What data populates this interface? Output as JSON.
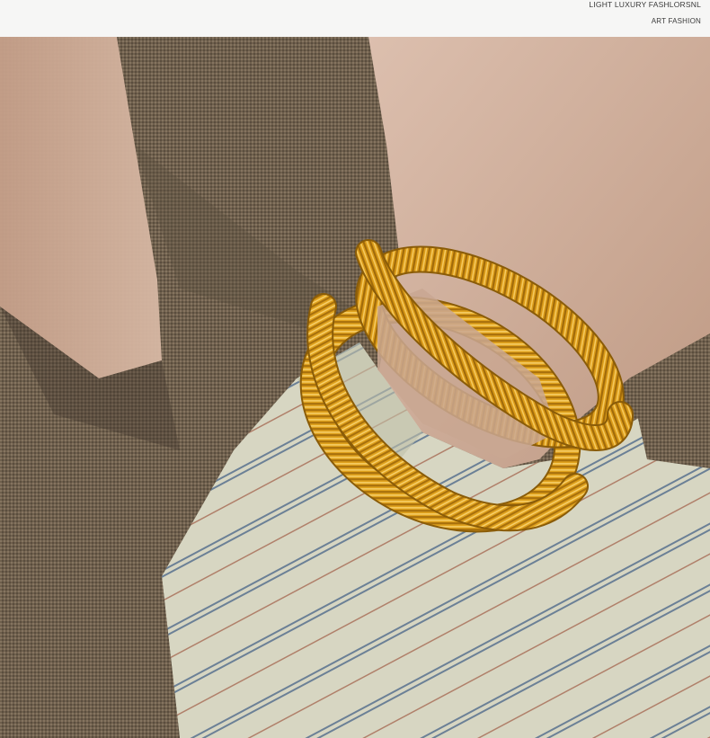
{
  "header": {
    "brand_line_1": "Light luxury fashlorsnl",
    "brand_line_2": "ART FASHION"
  },
  "photo": {
    "colors": {
      "jacket": "#6f604d",
      "jacket_shadow": "#4d4235",
      "skin": "#c9a792",
      "skin_light": "#dcbfae",
      "shirt": "#d7d6c2",
      "stripe_blue": "#6b8096",
      "stripe_red": "#b0806a",
      "gold": "#e0a21d",
      "gold_dark": "#a8700c",
      "gold_light": "#f7cf6a"
    }
  }
}
